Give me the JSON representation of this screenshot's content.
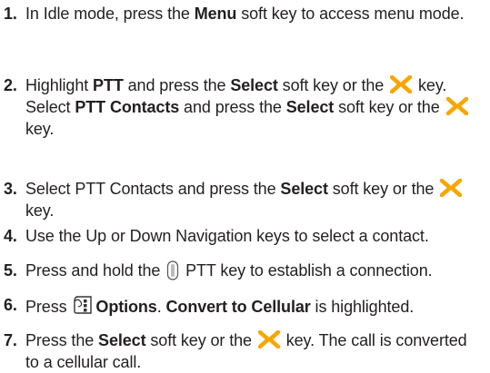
{
  "steps": [
    {
      "number": "1.",
      "parts": [
        {
          "t": "In Idle mode, press the "
        },
        {
          "b": "Menu"
        },
        {
          "t": " soft key to access menu mode."
        }
      ]
    },
    {
      "number": "2.",
      "parts": [
        {
          "t": "Highlight "
        },
        {
          "b": "PTT"
        },
        {
          "t": " and press the "
        },
        {
          "b": "Select"
        },
        {
          "t": " soft key or the "
        },
        {
          "icon": "ok-key-icon"
        },
        {
          "t": " key. Select "
        },
        {
          "b": "PTT Contacts"
        },
        {
          "t": " and press the "
        },
        {
          "b": "Select"
        },
        {
          "t": " soft key or the "
        },
        {
          "icon": "ok-key-icon"
        },
        {
          "t": " key."
        }
      ]
    },
    {
      "number": "3.",
      "parts": [
        {
          "t": "Select PTT Contacts and press the "
        },
        {
          "b": "Select"
        },
        {
          "t": " soft key or the "
        },
        {
          "icon": "ok-key-icon"
        },
        {
          "t": " key."
        }
      ]
    },
    {
      "number": "4.",
      "parts": [
        {
          "t": "Use the Up or Down Navigation keys to select a contact."
        }
      ]
    },
    {
      "number": "5.",
      "parts": [
        {
          "t": "Press and hold the "
        },
        {
          "icon": "ptt-key-icon"
        },
        {
          "t": " PTT key to establish a connection."
        }
      ]
    },
    {
      "number": "6.",
      "parts": [
        {
          "t": "Press "
        },
        {
          "icon": "options-key-icon"
        },
        {
          "b": "Options"
        },
        {
          "t": ". "
        },
        {
          "b": "Convert to Cellular"
        },
        {
          "t": " is highlighted."
        }
      ]
    },
    {
      "number": "7.",
      "parts": [
        {
          "t": "Press the "
        },
        {
          "b": "Select"
        },
        {
          "t": " soft key or the "
        },
        {
          "icon": "ok-key-icon"
        },
        {
          "t": " key. The call is converted to a cellular call."
        }
      ]
    }
  ],
  "colors": {
    "text": "#231f20",
    "ok_key_icon": "#f7a600"
  }
}
